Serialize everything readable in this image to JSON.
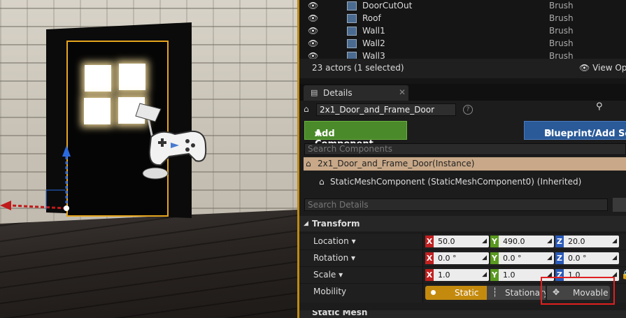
{
  "outliner": {
    "rows": [
      {
        "name": "DoorCutOut",
        "type": "Brush"
      },
      {
        "name": "Roof",
        "type": "Brush"
      },
      {
        "name": "Wall1",
        "type": "Brush"
      },
      {
        "name": "Wall2",
        "type": "Brush"
      },
      {
        "name": "Wall3",
        "type": "Brush"
      }
    ],
    "actor_count": "23 actors (1 selected)",
    "view_options": "View Opt"
  },
  "details": {
    "tab_label": "Details",
    "actor_name": "2x1_Door_and_Frame_Door",
    "add_component": "Add Component",
    "blueprint_button": "Blueprint/Add Sc",
    "search_components_placeholder": "Search Components",
    "instance_label": "2x1_Door_and_Frame_Door(Instance)",
    "component_label": "StaticMeshComponent (StaticMeshComponent0) (Inherited)",
    "search_details_placeholder": "Search Details",
    "transform_header": "Transform",
    "location": {
      "label": "Location",
      "x": "50.0",
      "y": "490.0",
      "z": "20.0"
    },
    "rotation": {
      "label": "Rotation",
      "x": "0.0 °",
      "y": "0.0 °",
      "z": "0.0 °"
    },
    "scale": {
      "label": "Scale",
      "x": "1.0",
      "y": "1.0",
      "z": "1.0"
    },
    "mobility": {
      "label": "Mobility",
      "options": [
        "Static",
        "Stationary",
        "Movable"
      ],
      "selected": "Static"
    },
    "next_section": "Static Mesh"
  },
  "axis_labels": {
    "x": "X",
    "y": "Y",
    "z": "Z"
  },
  "colors": {
    "accent": "#c48a0e",
    "add_component": "#4a8a2a",
    "blueprint": "#2a5a98",
    "highlight": "#e02020"
  }
}
